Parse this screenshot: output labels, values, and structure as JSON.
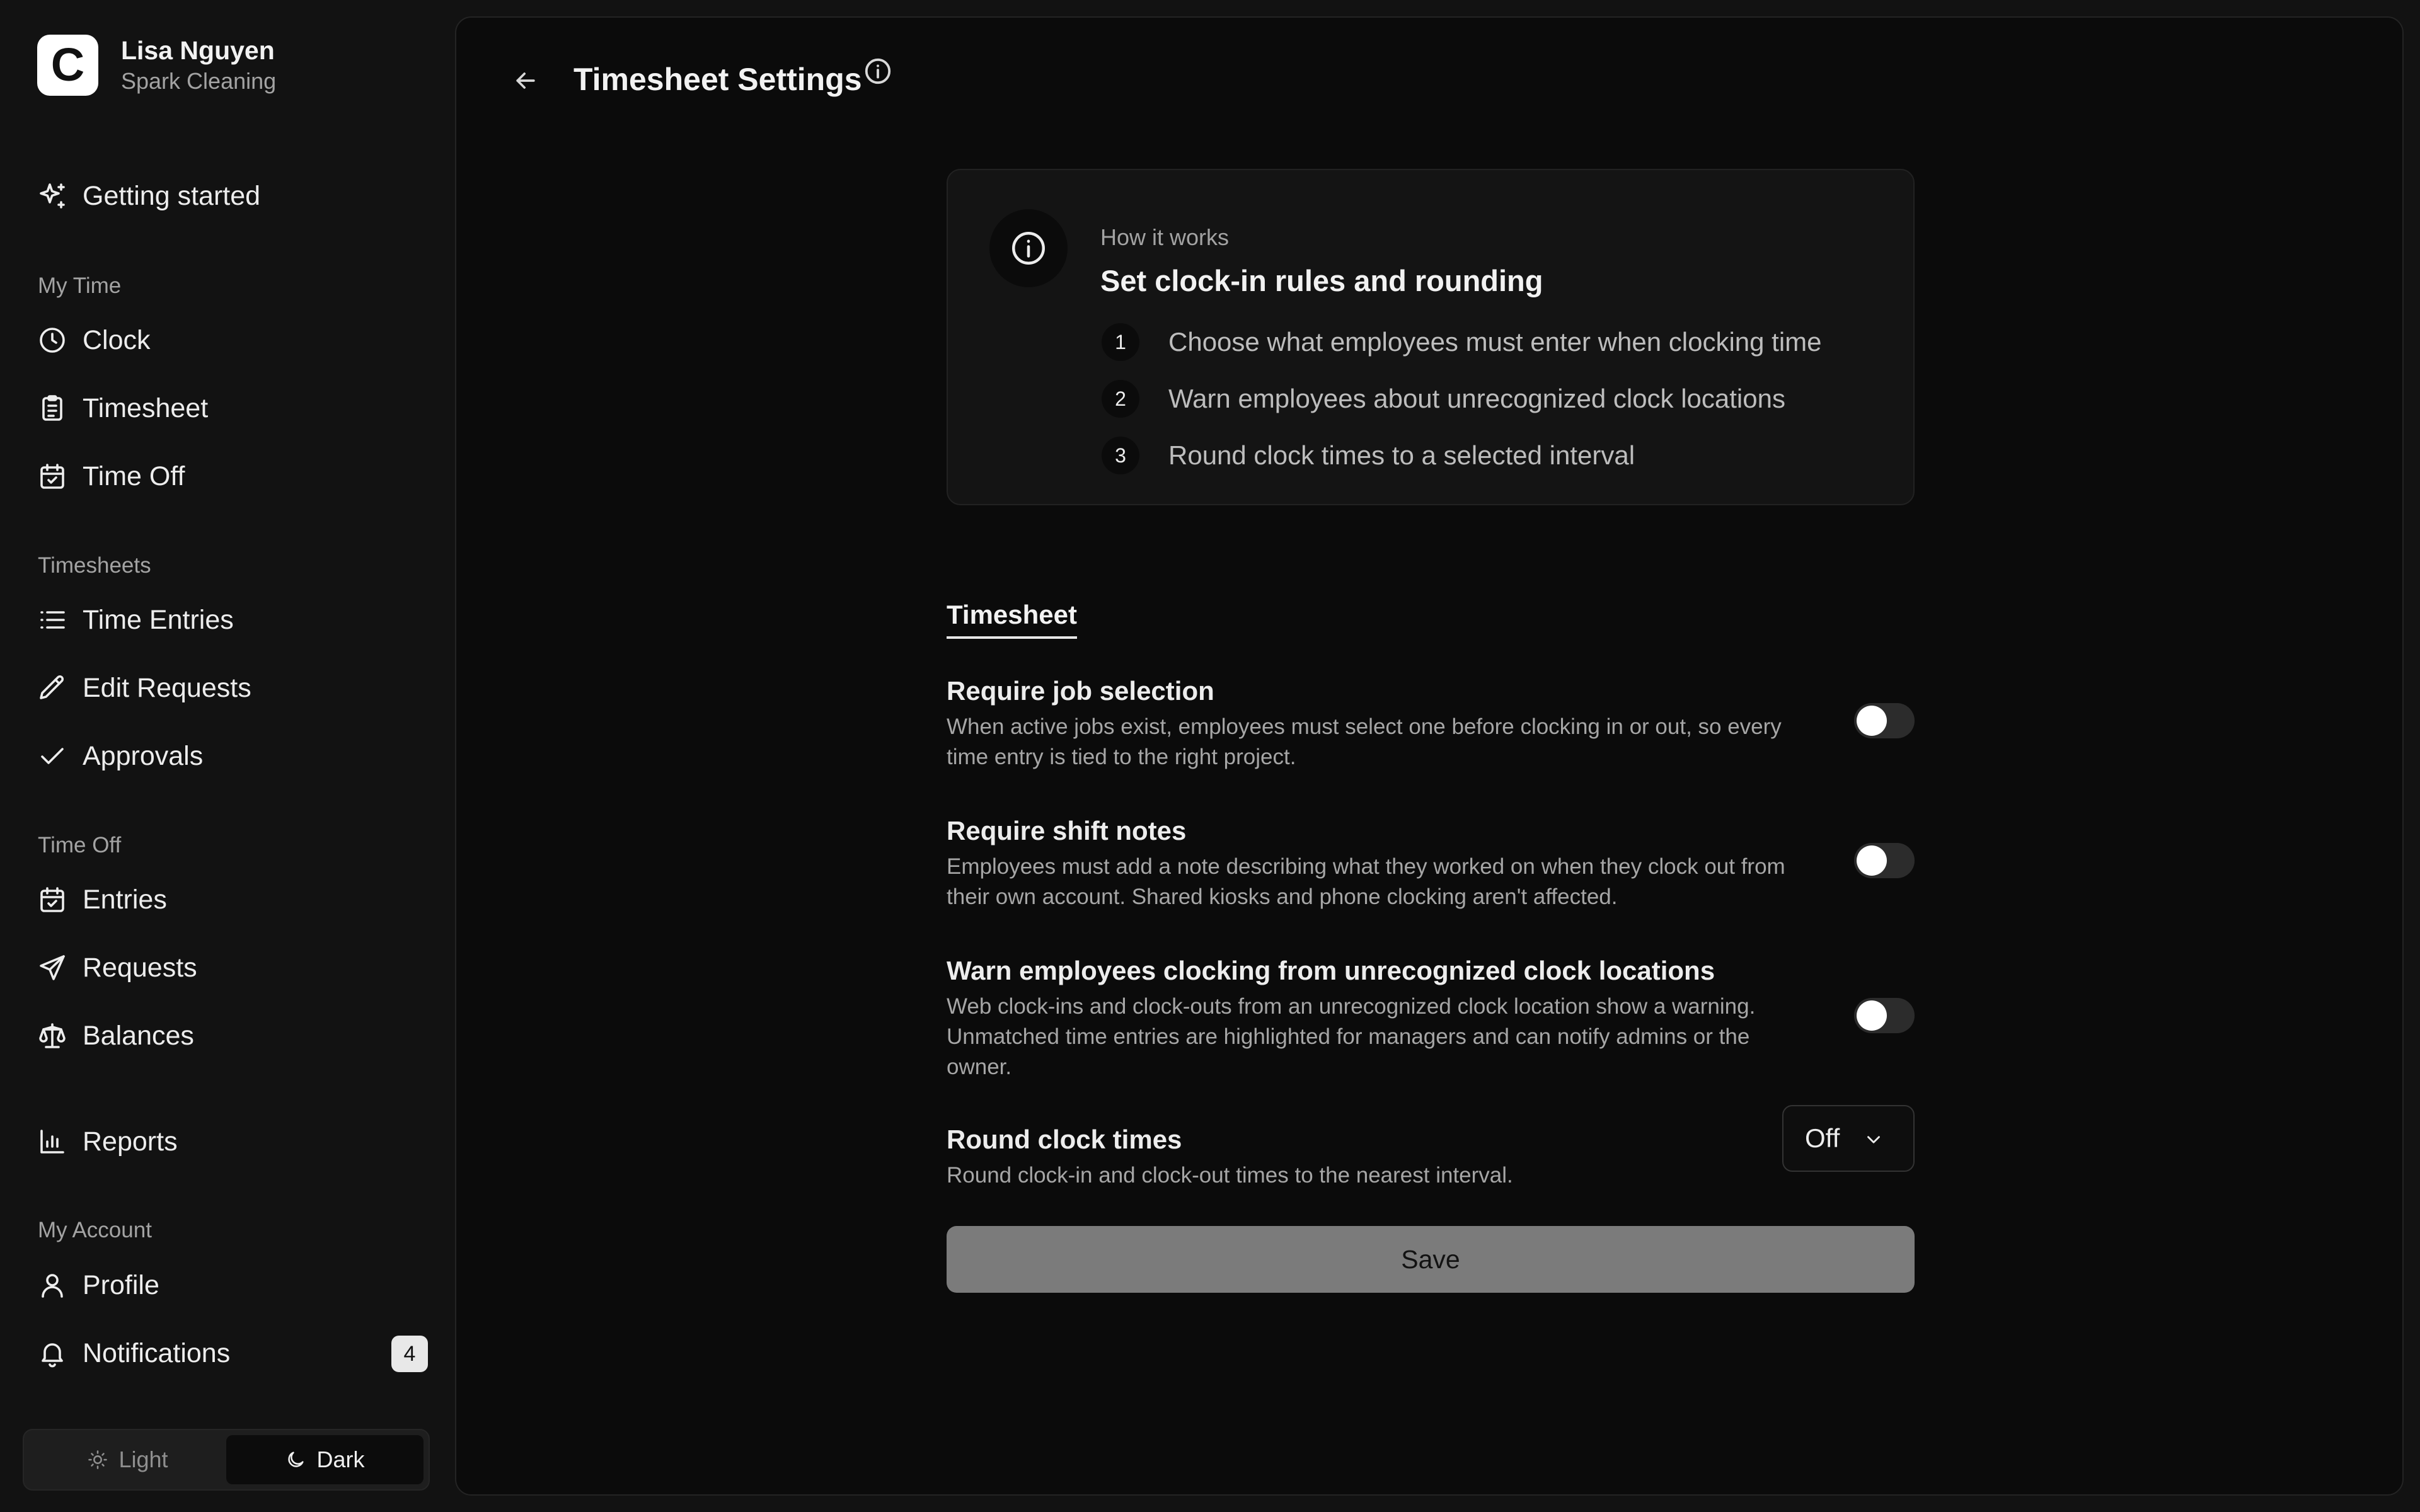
{
  "account": {
    "logo_letter": "C",
    "name": "Lisa Nguyen",
    "organization": "Spark Cleaning"
  },
  "sidebar": {
    "getting_started": "Getting started",
    "sections": {
      "my_time": "My Time",
      "timesheets": "Timesheets",
      "time_off": "Time Off",
      "my_account": "My Account"
    },
    "items": {
      "clock": "Clock",
      "timesheet": "Timesheet",
      "time_off": "Time Off",
      "time_entries": "Time Entries",
      "edit_requests": "Edit Requests",
      "approvals": "Approvals",
      "entries": "Entries",
      "requests": "Requests",
      "balances": "Balances",
      "reports": "Reports",
      "profile": "Profile",
      "notifications": "Notifications"
    },
    "notifications_count": "4",
    "theme": {
      "light": "Light",
      "dark": "Dark",
      "active": "dark"
    }
  },
  "header": {
    "title": "Timesheet Settings"
  },
  "how_it_works": {
    "eyebrow": "How it works",
    "heading": "Set clock-in rules and rounding",
    "steps": [
      {
        "num": "1",
        "text": "Choose what employees must enter when clocking time"
      },
      {
        "num": "2",
        "text": "Warn employees about unrecognized clock locations"
      },
      {
        "num": "3",
        "text": "Round clock times to a selected interval"
      }
    ]
  },
  "tabs": {
    "timesheet": "Timesheet"
  },
  "settings": [
    {
      "title": "Require job selection",
      "description": "When active jobs exist, employees must select one before clocking in or out, so every time entry is tied to the right project.",
      "enabled": false
    },
    {
      "title": "Require shift notes",
      "description": "Employees must add a note describing what they worked on when they clock out from their own account. Shared kiosks and phone clocking aren't affected.",
      "enabled": false
    },
    {
      "title": "Warn employees clocking from unrecognized clock locations",
      "description": "Web clock-ins and clock-outs from an unrecognized clock location show a warning. Unmatched time entries are highlighted for managers and can notify admins or the owner.",
      "enabled": false
    }
  ],
  "rounding": {
    "title": "Round clock times",
    "description": "Round clock-in and clock-out times to the nearest interval.",
    "selected": "Off"
  },
  "save_label": "Save",
  "colors": {
    "background": "#121212",
    "panel": "#0b0b0b",
    "card": "#141414",
    "save_button": "#7b7b7b"
  }
}
